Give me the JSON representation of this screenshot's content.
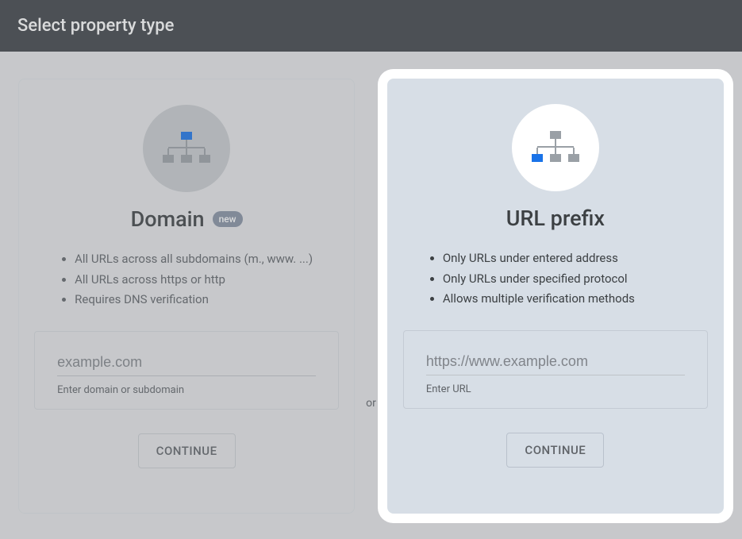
{
  "header": {
    "title": "Select property type"
  },
  "divider": {
    "label": "or"
  },
  "domain_card": {
    "title": "Domain",
    "badge": "new",
    "features": [
      "All URLs across all subdomains (m., www. ...)",
      "All URLs across https or http",
      "Requires DNS verification"
    ],
    "input_placeholder": "example.com",
    "input_helper": "Enter domain or subdomain",
    "button": "CONTINUE"
  },
  "urlprefix_card": {
    "title": "URL prefix",
    "features": [
      "Only URLs under entered address",
      "Only URLs under specified protocol",
      "Allows multiple verification methods"
    ],
    "input_placeholder": "https://www.example.com",
    "input_helper": "Enter URL",
    "button": "CONTINUE"
  },
  "colors": {
    "accent_blue": "#1a73e8",
    "muted_grey": "#9aa0a6"
  }
}
